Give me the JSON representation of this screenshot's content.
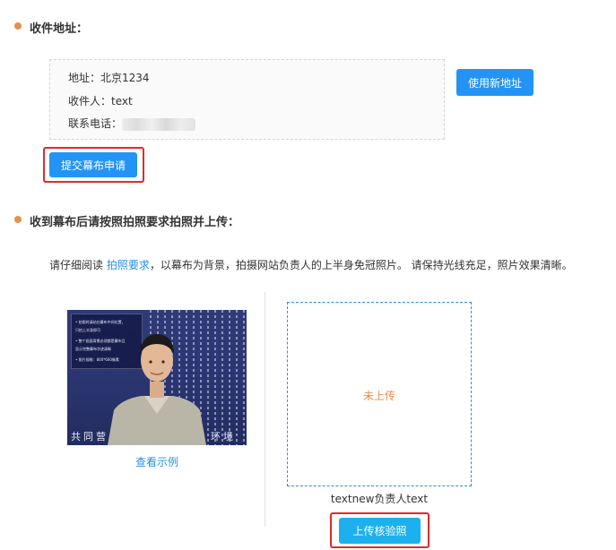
{
  "shipping": {
    "title": "收件地址：",
    "address": "地址：北京1234",
    "recipient": "收件人：text",
    "phone_label": "联系电话：",
    "new_address_button": "使用新地址",
    "submit_button": "提交幕布申请"
  },
  "photo_upload": {
    "title": "收到幕布后请按照拍照要求拍照并上传：",
    "instruction_prefix": "请仔细阅读 ",
    "instruction_link": "拍照要求",
    "instruction_suffix": "，以幕布为背景，拍摄网站负责人的上半身免冠照片。 请保持光线充足，照片效果清晰。",
    "example": {
      "notes": [
        "• 拍照时请站在幕布中间位置，",
        "  只拍上半身即可",
        "• 整个画面背景必须都是幕布且",
        "  显示完整幕布字迹清晰",
        "• 照片规格：800*600像素"
      ],
      "backdrop_text_left": "共同营",
      "backdrop_text_right": "环境",
      "link": "查看示例"
    },
    "upload_status": "未上传",
    "upload_caption": "textnew负责人text",
    "upload_button": "上传核验照"
  },
  "colors": {
    "accent_orange": "#e98e4a",
    "button_blue": "#2394f6",
    "button_cyan": "#1cb0ee",
    "link_blue": "#2a8fe0",
    "highlight_red": "#e12a2a"
  }
}
